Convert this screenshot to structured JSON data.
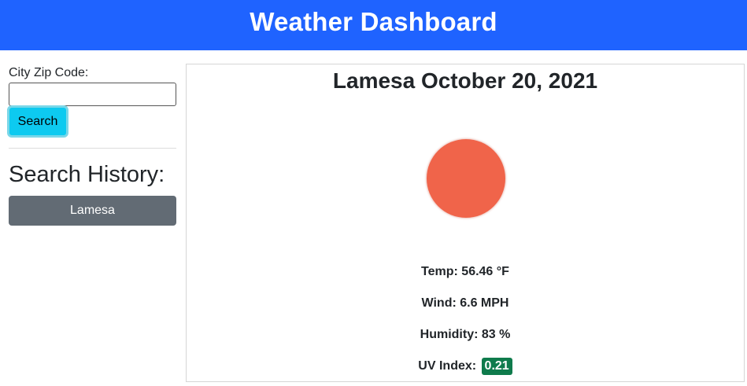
{
  "header": {
    "title": "Weather Dashboard"
  },
  "search": {
    "label": "City Zip Code:",
    "input_value": "",
    "placeholder": "",
    "button_label": "Search"
  },
  "history": {
    "title": "Search History:",
    "items": [
      {
        "label": "Lamesa"
      }
    ]
  },
  "current": {
    "title": "Lamesa October 20, 2021",
    "icon": "sun-circle-icon",
    "temp": "Temp: 56.46 °F",
    "wind": "Wind: 6.6 MPH",
    "humidity": "Humidity: 83 %",
    "uv_label": "UV Index:",
    "uv_value": "0.21"
  },
  "colors": {
    "header_bg": "#1f63ff",
    "search_button": "#0dcaf0",
    "history_button": "#626b74",
    "icon_color": "#f0644a",
    "uv_badge": "#0f7b4c"
  }
}
